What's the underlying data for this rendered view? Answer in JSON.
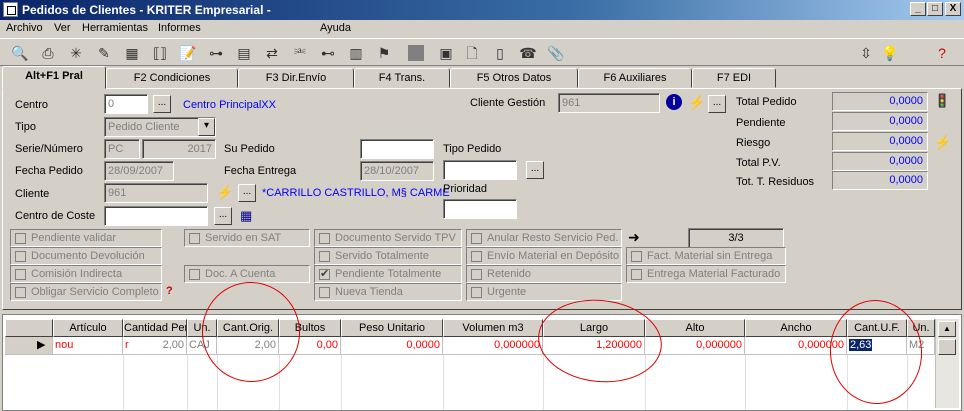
{
  "window": {
    "title": "Pedidos de Clientes - KRITER Empresarial -",
    "min": "_",
    "max": "□",
    "close": "X"
  },
  "menu": [
    "Archivo",
    "Ver",
    "Herramientas",
    "Informes",
    "Ayuda"
  ],
  "tabs": [
    "Alt+F1 Pral",
    "F2 Condiciones",
    "F3 Dir.Envío",
    "F4 Trans.",
    "F5 Otros Datos",
    "F6 Auxiliares",
    "F7 EDI"
  ],
  "form": {
    "centro_label": "Centro",
    "centro_value": "0",
    "centro_name": "Centro PrincipalXX",
    "tipo_label": "Tipo",
    "tipo_value": "Pedido Cliente",
    "serie_label": "Serie/Número",
    "serie_value": "PC",
    "numero_value": "2017",
    "fecha_pedido_label": "Fecha Pedido",
    "fecha_pedido_value": "28/09/2007",
    "cliente_label": "Cliente",
    "cliente_value": "961",
    "cliente_name": "*CARRILLO CASTRILLO, M§ CARME",
    "centro_coste_label": "Centro de Coste",
    "centro_coste_value": "",
    "su_pedido_label": "Su Pedido",
    "su_pedido_value": "",
    "fecha_entrega_label": "Fecha Entrega",
    "fecha_entrega_value": "28/10/2007",
    "tipo_pedido_label": "Tipo Pedido",
    "tipo_pedido_value": "",
    "prioridad_label": "Prioridad",
    "prioridad_value": "",
    "cliente_gestion_label": "Cliente Gestión",
    "cliente_gestion_value": "961",
    "button_dots": "..."
  },
  "totals": [
    {
      "label": "Total Pedido",
      "value": "0,0000"
    },
    {
      "label": "Pendiente",
      "value": "0,0000"
    },
    {
      "label": "Riesgo",
      "value": "0,0000"
    },
    {
      "label": "Total P.V.",
      "value": "0,0000"
    },
    {
      "label": "Tot. T. Residuos",
      "value": "0,0000"
    }
  ],
  "checkboxes": {
    "col1": [
      "Pendiente validar",
      "Documento Devolución",
      "Comisión Indirecta",
      "Obligar Servicio Completo"
    ],
    "col2": [
      "Servido en SAT",
      "Doc. A Cuenta"
    ],
    "col3": [
      "Documento Servido TPV",
      "Servido Totalmente",
      "Pendiente Totalmente",
      "Nueva Tienda"
    ],
    "col4": [
      "Anular Resto Servicio Ped.",
      "Envío Material en Depósito",
      "Retenido",
      "Urgente"
    ],
    "col5": [
      "Fact. Material sin Entrega",
      "Entrega Material Facturado"
    ],
    "col3_checked_index": 2,
    "page_counter": "3/3"
  },
  "grid": {
    "headers": [
      "Artículo",
      "Cantidad Pendiente",
      "Un.",
      "Cant.Orig.",
      "Bultos",
      "Peso Unitario",
      "Volumen m3",
      "Largo",
      "Alto",
      "Ancho",
      "Cant.U.F.",
      "Un."
    ],
    "row": [
      "nou",
      "r",
      "2,00",
      "CAJ",
      "2,00",
      "0,00",
      "0,0000",
      "0,000000",
      "1,200000",
      "0,000000",
      "0,000000",
      "2,63",
      "M2"
    ]
  },
  "colors": {
    "title_start": "#0a246a",
    "title_end": "#a6caf0",
    "face": "#d4d0c8",
    "link_blue": "#0000ff",
    "value_red": "#ff0000",
    "annotation_red": "#e00000"
  }
}
